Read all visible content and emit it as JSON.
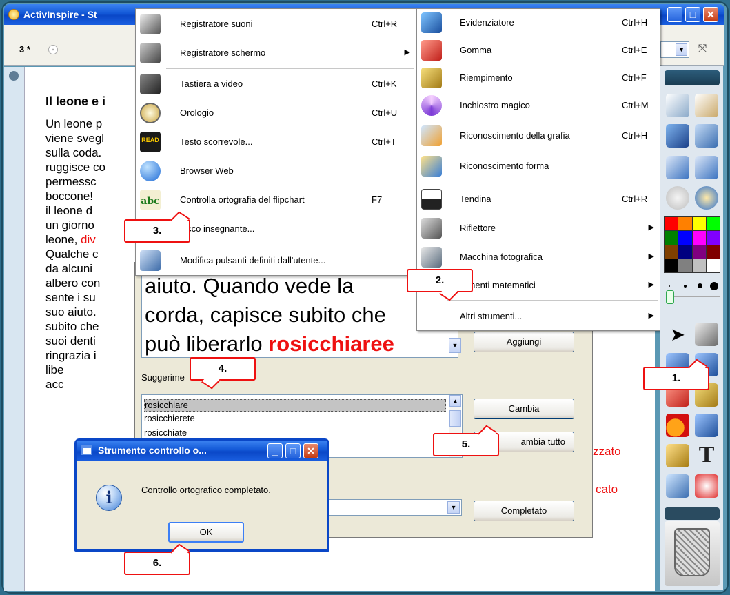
{
  "window": {
    "app_title": "ActivInspire - St",
    "tab_label": "3 *",
    "tab_close": "×"
  },
  "document": {
    "title": "Il leone e i",
    "lines": [
      "Un leone p",
      "viene svegl",
      "sulla coda.",
      "ruggisce co",
      "permessc",
      "boccone!",
      "il leone d",
      "un giorno",
      "leone, div",
      "Qualche c",
      "da alcuni",
      "albero con",
      "sente i su",
      "suo aiuto.",
      "subito che",
      "suoi denti",
      "ringrazia i",
      "libe",
      "acc"
    ],
    "red_fragment": "div",
    "right_red_1": "zzato",
    "right_red_2": "cato"
  },
  "menu_left": {
    "items": [
      {
        "label": "Registratore suoni",
        "shortcut": "Ctrl+R"
      },
      {
        "label": "Registratore schermo",
        "shortcut": ""
      },
      {
        "label": "Tastiera a video",
        "shortcut": "Ctrl+K"
      },
      {
        "label": "Orologio",
        "shortcut": "Ctrl+U"
      },
      {
        "label": "Testo scorrevole...",
        "shortcut": "Ctrl+T"
      },
      {
        "label": "Browser Web",
        "shortcut": ""
      },
      {
        "label": "Controlla ortografia del flipchart",
        "shortcut": "F7"
      },
      {
        "label": "locco insegnante...",
        "shortcut": ""
      },
      {
        "label": "Modifica pulsanti definiti dall'utente...",
        "shortcut": ""
      }
    ],
    "icon_text_read": "READ",
    "icon_text_abc": "abc"
  },
  "menu_right": {
    "items": [
      {
        "label": "Evidenziatore",
        "shortcut": "Ctrl+H"
      },
      {
        "label": "Gomma",
        "shortcut": "Ctrl+E"
      },
      {
        "label": "Riempimento",
        "shortcut": "Ctrl+F"
      },
      {
        "label": "Inchiostro magico",
        "shortcut": "Ctrl+M"
      },
      {
        "label": "Riconoscimento della grafia",
        "shortcut": "Ctrl+H"
      },
      {
        "label": "Riconoscimento forma",
        "shortcut": ""
      },
      {
        "label": "Tendina",
        "shortcut": "Ctrl+R"
      },
      {
        "label": "Riflettore",
        "shortcut": ""
      },
      {
        "label": "Macchina fotografica",
        "shortcut": ""
      },
      {
        "label": "rumenti matematici",
        "shortcut": ""
      },
      {
        "label": "Altri strumenti...",
        "shortcut": ""
      }
    ]
  },
  "spell_dialog": {
    "text_lines": [
      "aiuto. Quando vede la",
      "corda, capisce subito che",
      "può liberarlo "
    ],
    "misspelled": "rosicchiaree",
    "add_button": "Aggiungi",
    "suggestions_label": "Suggerime",
    "suggestions": [
      "rosicchiare",
      "rosicchierete",
      "rosicchiate"
    ],
    "change_button": "Cambia",
    "change_all_button": "ambia tutto",
    "done_button": "Completato"
  },
  "message_box": {
    "title": "Strumento controllo o...",
    "message": "Controllo ortografico completato.",
    "ok_button": "OK",
    "info_glyph": "i"
  },
  "callouts": [
    "1.",
    "2.",
    "3.",
    "4.",
    "5.",
    "6."
  ],
  "palette_colors": [
    "#ff0000",
    "#ff8000",
    "#ffff00",
    "#00ff00",
    "#008000",
    "#0000ff",
    "#ff00ff",
    "#8000ff",
    "#804000",
    "#000080",
    "#800080",
    "#800000",
    "#000000",
    "#808080",
    "#c0c0c0",
    "#ffffff"
  ],
  "toolbox": {
    "text_tool_glyph": "T"
  }
}
